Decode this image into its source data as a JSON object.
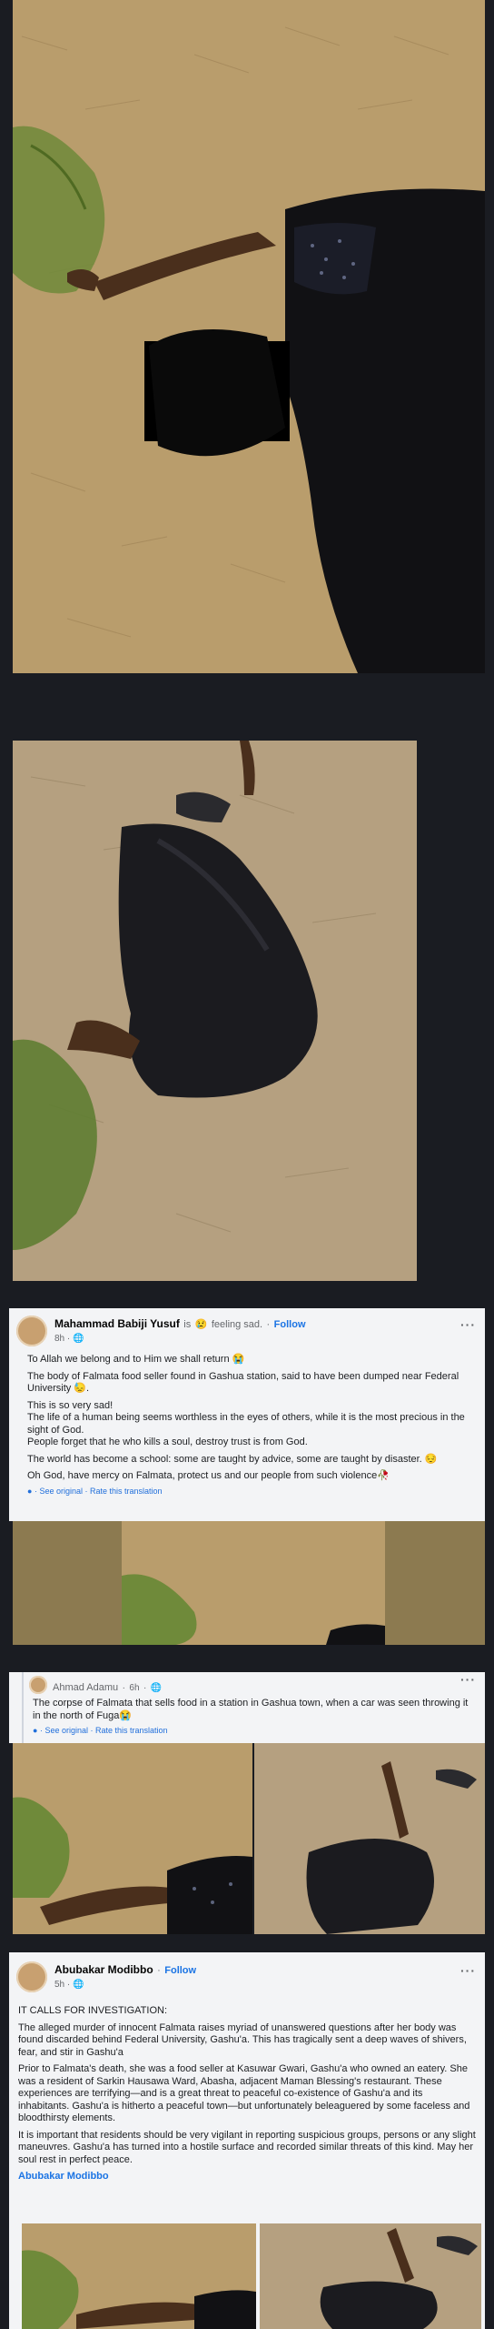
{
  "posts": [
    {
      "author": "Mahammad Babiji Yusuf",
      "feeling_prefix": "is",
      "feeling": "feeling sad.",
      "follow": "Follow",
      "time": "8h",
      "lines": [
        "To Allah we belong and to Him we shall return 😭",
        "The body of Falmata food seller found in Gashua station, said to have been dumped near Federal University 😓.",
        "This is so very sad!",
        "The life of a human being seems worthless in the eyes of others, while it is the most precious in the sight of God.",
        "People forget that he who kills a soul, destroy trust is from God.",
        "The world has become a school: some are taught by advice, some are taught by disaster. 😔",
        "Oh God, have mercy on Falmata, protect us and our people from such violence🥀"
      ],
      "see_original": "See original",
      "rate": "Rate this translation"
    },
    {
      "author": "Ahmad Adamu",
      "time": "6h",
      "lines": [
        "The corpse of Falmata that sells food in a station in Gashua town, when a car was seen throwing it in the north of Fuga😭"
      ],
      "see_original": "See original",
      "rate": "Rate this translation"
    },
    {
      "author": "Abubakar Modibbo",
      "follow": "Follow",
      "time": "5h",
      "lines": [
        "IT CALLS FOR INVESTIGATION:",
        "The alleged murder of innocent Falmata raises myriad of unanswered questions after her body was found discarded behind Federal University, Gashu'a. This has tragically sent a deep waves of shivers, fear, and stir in Gashu'a",
        "Prior to Falmata's death, she was a food seller at Kasuwar Gwari, Gashu'a who owned an eatery. She was a resident of Sarkin Hausawa Ward, Abasha, adjacent Maman Blessing's restaurant. These experiences are terrifying—and is a great threat to peaceful co-existence of Gashu'a and its inhabitants. Gashu'a is hitherto a peaceful town—but unfortunately beleaguered by some faceless and bloodthirsty elements.",
        "It is important that residents should be very vigilant in reporting suspicious groups, persons or any slight maneuvres. Gashu'a has turned into a hostile surface and recorded similar threats of this kind. May her soul rest in perfect peace."
      ],
      "signature": "Abubakar Modibbo"
    }
  ],
  "colors": {
    "link": "#1b74e4",
    "page_bg": "#1a1c22",
    "soil": "#b89a6a"
  },
  "icons": [
    "globe-icon",
    "more-options-icon",
    "sad-face-icon"
  ]
}
